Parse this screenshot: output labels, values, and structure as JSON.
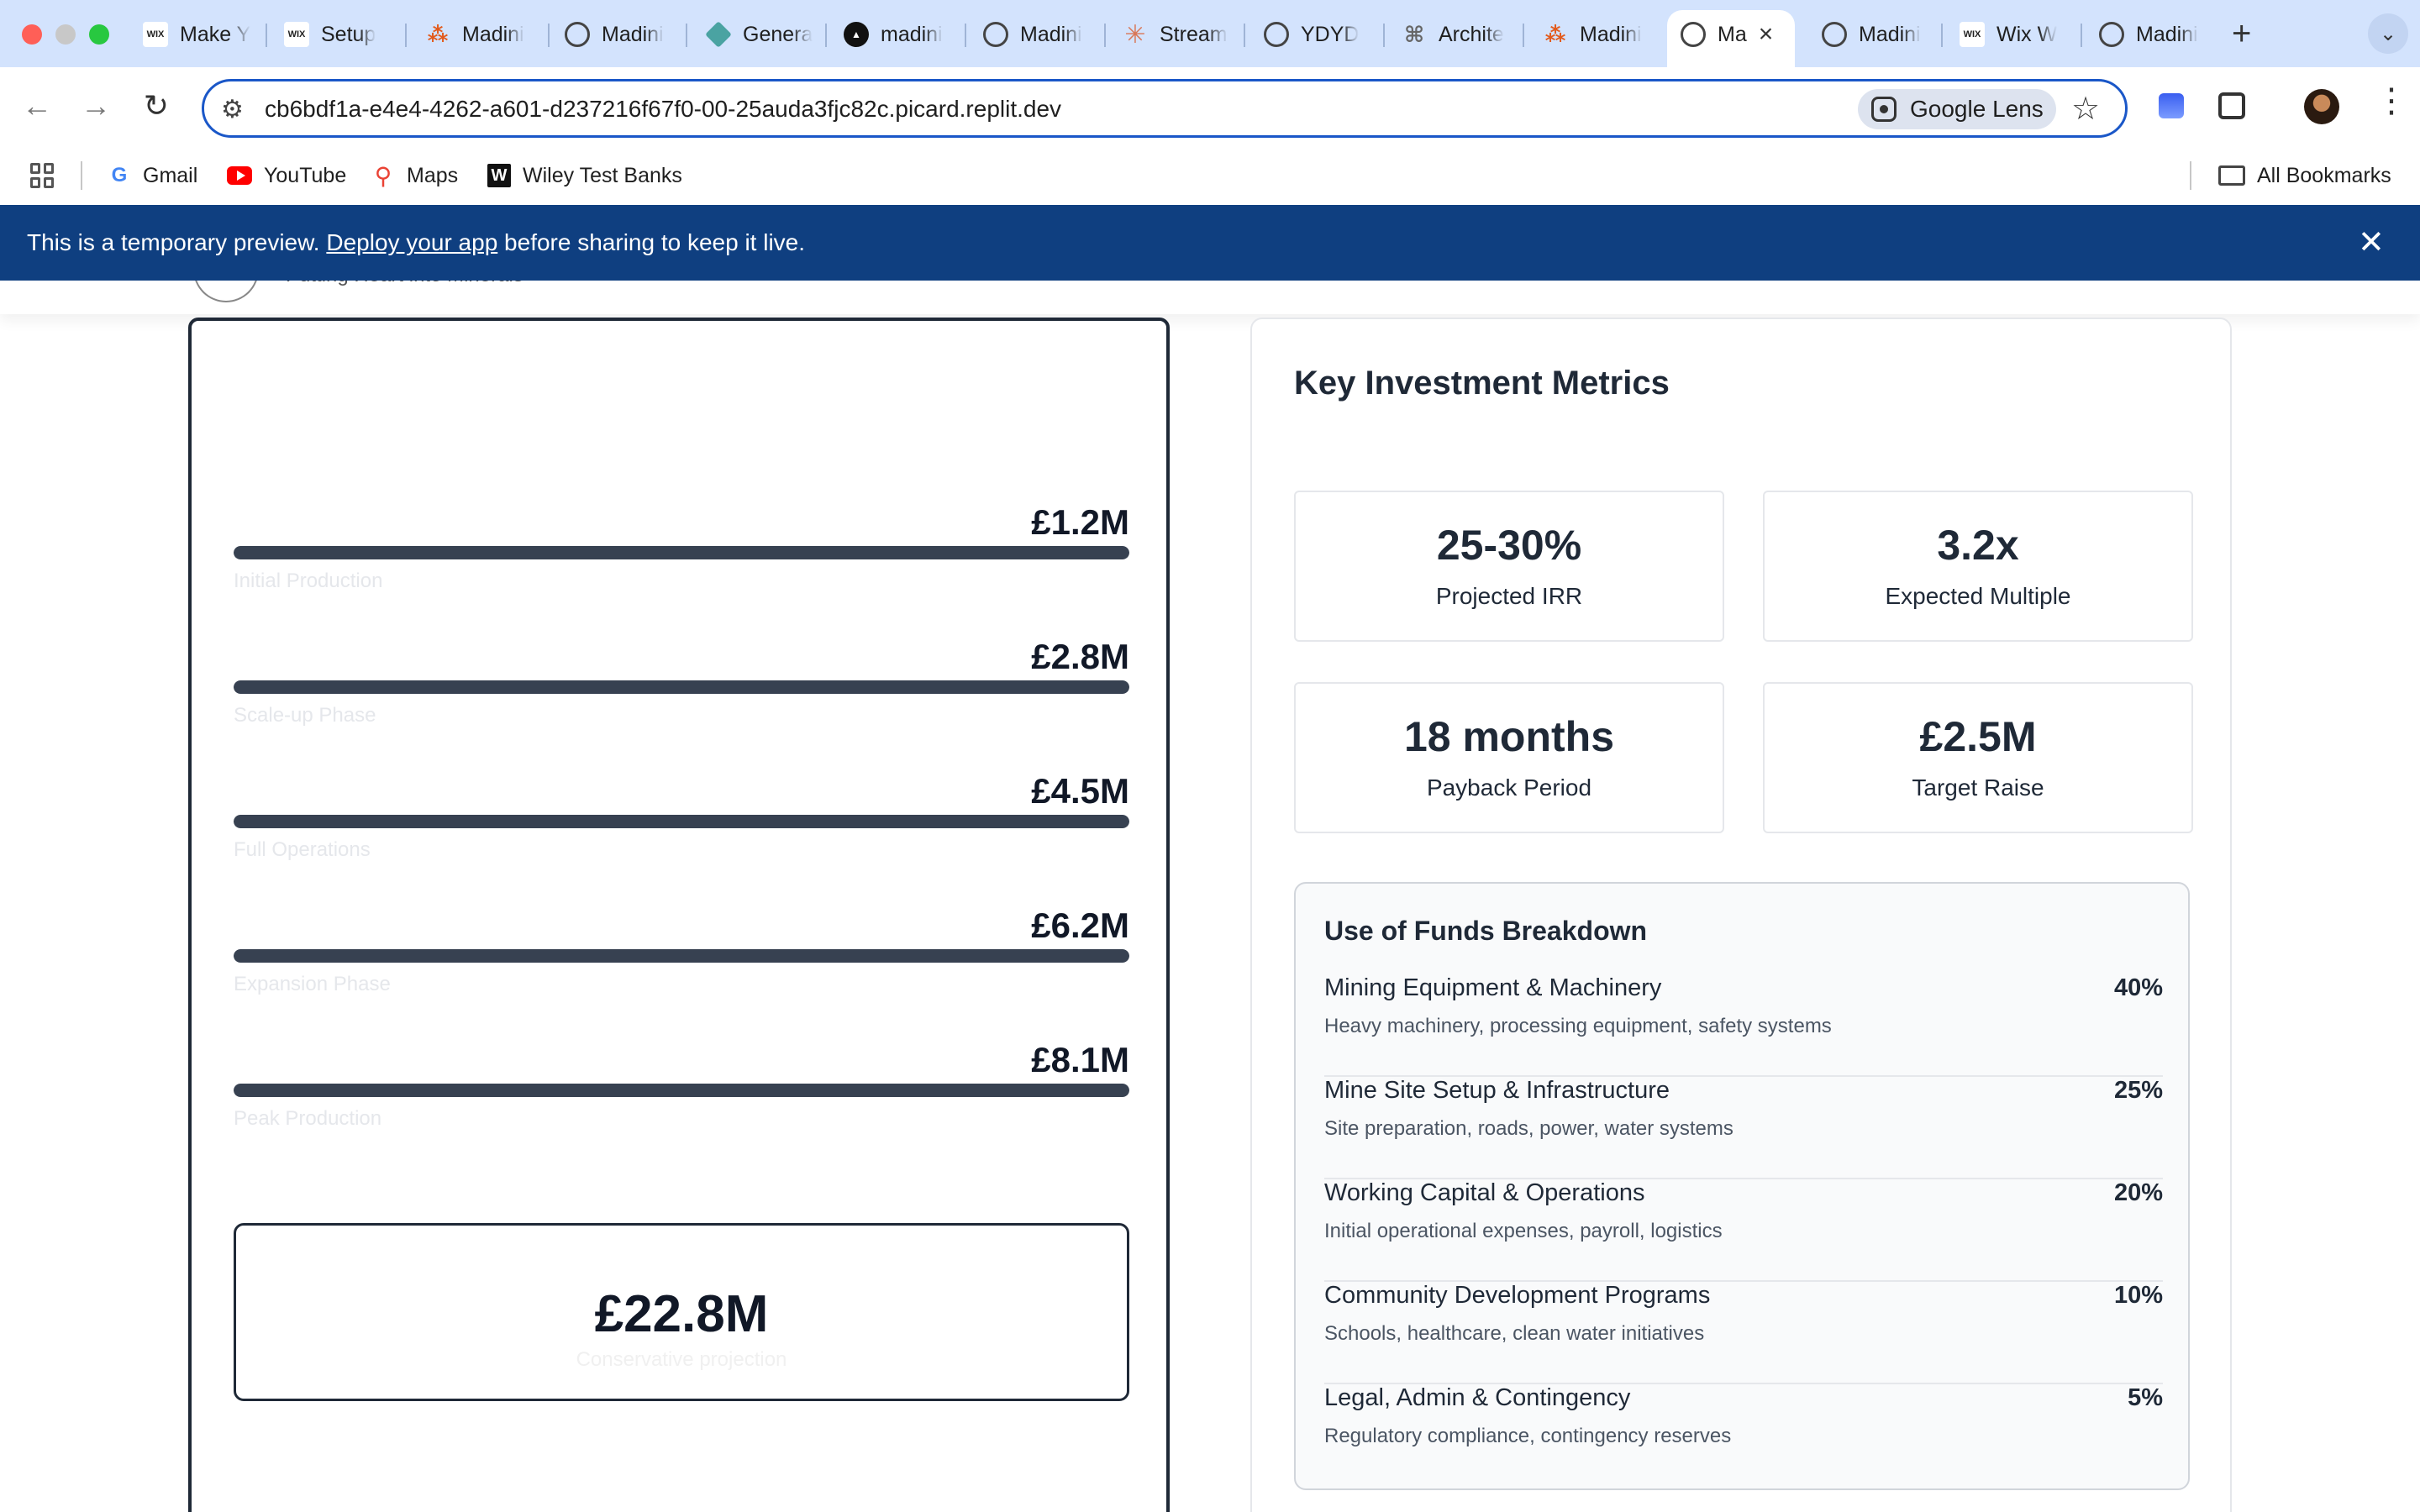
{
  "browser": {
    "tabs": [
      {
        "label": "Make Y",
        "icon": "wix-icon"
      },
      {
        "label": "Setup",
        "icon": "wix-icon"
      },
      {
        "label": "Madini",
        "icon": "orange-logo-icon"
      },
      {
        "label": "Madini",
        "icon": "globe-icon"
      },
      {
        "label": "Genera",
        "icon": "teal-diamond-icon"
      },
      {
        "label": "madini",
        "icon": "black-triangle-icon"
      },
      {
        "label": "Madini",
        "icon": "globe-icon"
      },
      {
        "label": "Stream",
        "icon": "claude-star-icon"
      },
      {
        "label": "YDYD",
        "icon": "globe-icon"
      },
      {
        "label": "Archite",
        "icon": "architecture-icon"
      },
      {
        "label": "Madini",
        "icon": "orange-logo-icon"
      },
      {
        "label": "Ma",
        "icon": "globe-icon",
        "active": true
      },
      {
        "label": "Madini",
        "icon": "globe-icon"
      },
      {
        "label": "Wix W",
        "icon": "wix-icon"
      },
      {
        "label": "Madini",
        "icon": "globe-icon"
      }
    ],
    "url": "cb6bdf1a-e4e4-4262-a601-d237216f67f0-00-25auda3fjc82c.picard.replit.dev",
    "lens_label": "Google Lens",
    "bookmarks": [
      {
        "label": "Gmail",
        "icon": "google-icon"
      },
      {
        "label": "YouTube",
        "icon": "youtube-icon"
      },
      {
        "label": "Maps",
        "icon": "maps-icon"
      },
      {
        "label": "Wiley Test Banks",
        "icon": "wiley-icon"
      }
    ],
    "all_bookmarks": "All Bookmarks"
  },
  "banner": {
    "prefix": "This is a temporary preview.",
    "link": "Deploy your app",
    "suffix": "before sharing to keep it live.",
    "color": "#0f3f80"
  },
  "site": {
    "tagline": "Putting Heart into Minerals"
  },
  "projection": {
    "rows": [
      {
        "value": "£1.2M",
        "label": "Initial Production",
        "fill": 1.0
      },
      {
        "value": "£2.8M",
        "label": "Scale-up Phase",
        "fill": 1.0
      },
      {
        "value": "£4.5M",
        "label": "Full Operations",
        "fill": 1.0
      },
      {
        "value": "£6.2M",
        "label": "Expansion Phase",
        "fill": 1.0
      },
      {
        "value": "£8.1M",
        "label": "Peak Production",
        "fill": 1.0
      }
    ],
    "total": "£22.8M",
    "total_label": "Conservative projection"
  },
  "metrics": {
    "title": "Key Investment Metrics",
    "items": [
      {
        "value": "25-30%",
        "label": "Projected IRR"
      },
      {
        "value": "3.2x",
        "label": "Expected Multiple"
      },
      {
        "value": "18 months",
        "label": "Payback Period"
      },
      {
        "value": "£2.5M",
        "label": "Target Raise"
      }
    ],
    "funds": {
      "title": "Use of Funds Breakdown",
      "items": [
        {
          "name": "Mining Equipment & Machinery",
          "pct": "40%",
          "desc": "Heavy machinery, processing equipment, safety systems"
        },
        {
          "name": "Mine Site Setup & Infrastructure",
          "pct": "25%",
          "desc": "Site preparation, roads, power, water systems"
        },
        {
          "name": "Working Capital & Operations",
          "pct": "20%",
          "desc": "Initial operational expenses, payroll, logistics"
        },
        {
          "name": "Community Development Programs",
          "pct": "10%",
          "desc": "Schools, healthcare, clean water initiatives"
        },
        {
          "name": "Legal, Admin & Contingency",
          "pct": "5%",
          "desc": "Regulatory compliance, contingency reserves"
        }
      ]
    }
  }
}
